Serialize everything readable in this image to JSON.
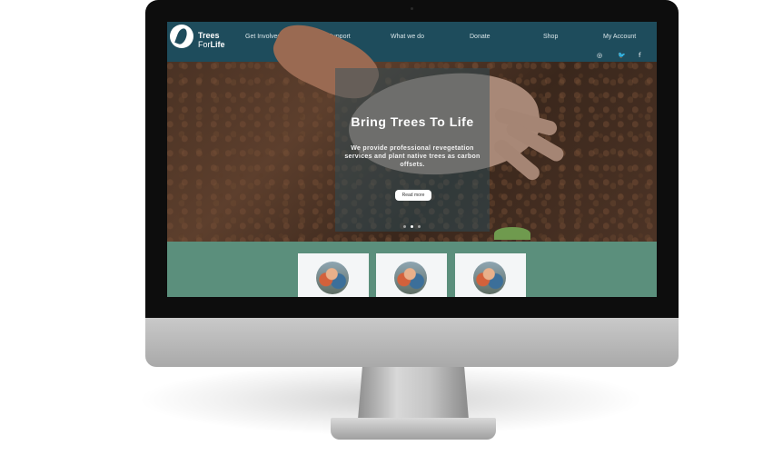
{
  "brand": {
    "line1": "Trees",
    "line2_a": "For",
    "line2_b": "Life"
  },
  "nav": {
    "items": [
      "Get Involved",
      "Get Support",
      "What we do",
      "Donate",
      "Shop",
      "My Account"
    ]
  },
  "social": {
    "instagram_icon": "instagram-icon",
    "twitter_icon": "twitter-icon",
    "facebook_icon": "facebook-icon",
    "instagram_glyph": "◎",
    "twitter_glyph": "🐦",
    "facebook_glyph": "f"
  },
  "hero": {
    "title": "Bring Trees To Life",
    "subtitle": "We provide professional revegetation services and plant native trees as carbon offsets.",
    "button_label": "Read more"
  },
  "device": {
    "apple_glyph": ""
  },
  "colors": {
    "nav_bg": "#1e4c5c",
    "section_bg": "#5b8f7c",
    "card_bg": "#f4f6f7"
  }
}
